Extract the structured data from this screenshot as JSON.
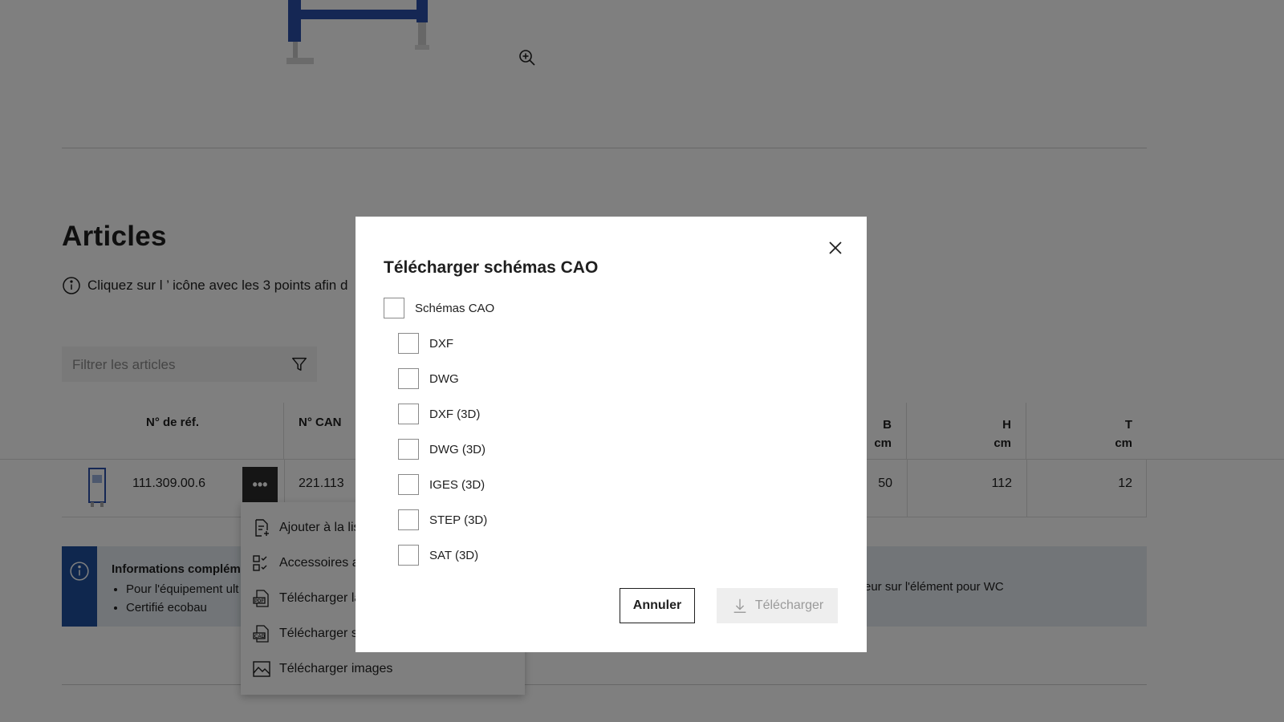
{
  "page": {
    "articles_title": "Articles",
    "info_hint": "Cliquez sur l ’ icône avec les 3 points afin d",
    "filter_placeholder": "Filtrer les articles"
  },
  "table": {
    "headers": {
      "ref": "N° de réf.",
      "can": "N° CAN",
      "b": "B",
      "h": "H",
      "t": "T",
      "unit": "cm"
    },
    "rows": [
      {
        "ref": "111.309.00.6",
        "can": "221.113",
        "b": "50",
        "h": "112",
        "t": "12",
        "more_label": "•••"
      }
    ]
  },
  "info_box": {
    "title": "Informations complém",
    "bullets": [
      "Pour l'équipement ult",
      "Certifié ecobau"
    ],
    "extra": "eur sur l'élément pour WC"
  },
  "context_menu": {
    "items": [
      {
        "label": "Ajouter à la lis",
        "icon": "add-to-list-icon"
      },
      {
        "label": "Accessoires a",
        "icon": "accessories-icon"
      },
      {
        "label": "Télécharger la",
        "icon": "pdf-icon"
      },
      {
        "label": "Télécharger s",
        "icon": "cad-icon"
      },
      {
        "label": "Télécharger images",
        "icon": "image-icon"
      }
    ]
  },
  "modal": {
    "title": "Télécharger schémas CAO",
    "parent_option": "Schémas CAO",
    "options": [
      "DXF",
      "DWG",
      "DXF (3D)",
      "DWG (3D)",
      "IGES (3D)",
      "STEP (3D)",
      "SAT (3D)"
    ],
    "cancel_label": "Annuler",
    "download_label": "Télécharger"
  },
  "colors": {
    "accent_blue": "#1e4f9c",
    "info_bg": "#e4eaf1",
    "overlay": "rgba(0,0,0,0.5)"
  }
}
